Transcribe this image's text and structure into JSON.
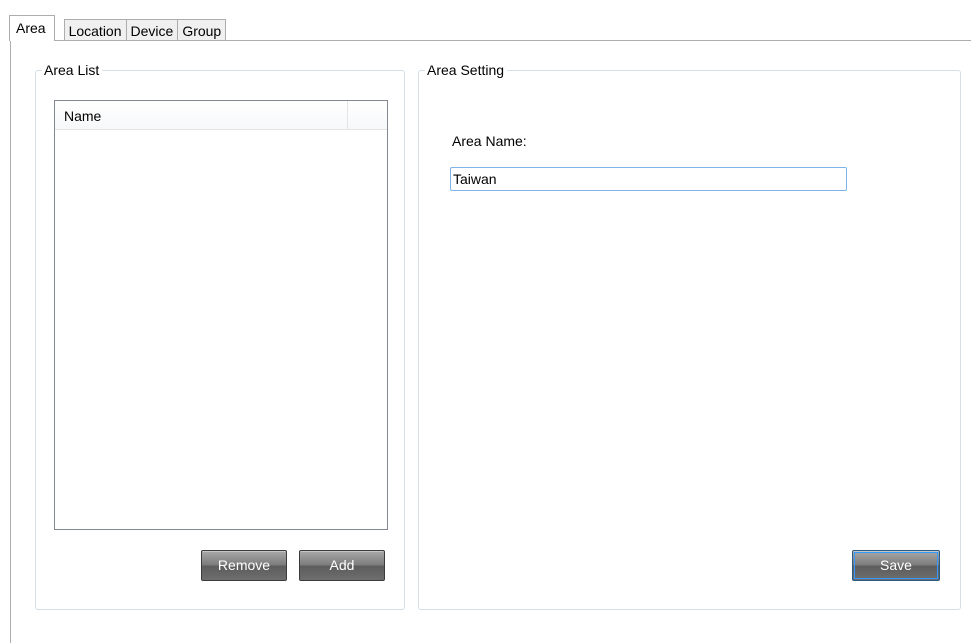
{
  "tabs": [
    {
      "label": "Area",
      "active": true
    },
    {
      "label": "Location",
      "active": false
    },
    {
      "label": "Device",
      "active": false
    },
    {
      "label": "Group",
      "active": false
    }
  ],
  "area_list": {
    "title": "Area List",
    "columns": [
      "Name"
    ],
    "rows": [],
    "remove_label": "Remove",
    "add_label": "Add"
  },
  "area_setting": {
    "title": "Area Setting",
    "name_label": "Area Name:",
    "name_value": "Taiwan",
    "save_label": "Save"
  },
  "colors": {
    "button_bg": "#6e6e6e",
    "button_text": "#ffffff",
    "input_border": "#7eb4ea",
    "groupbox_border": "#d5dfe5"
  }
}
